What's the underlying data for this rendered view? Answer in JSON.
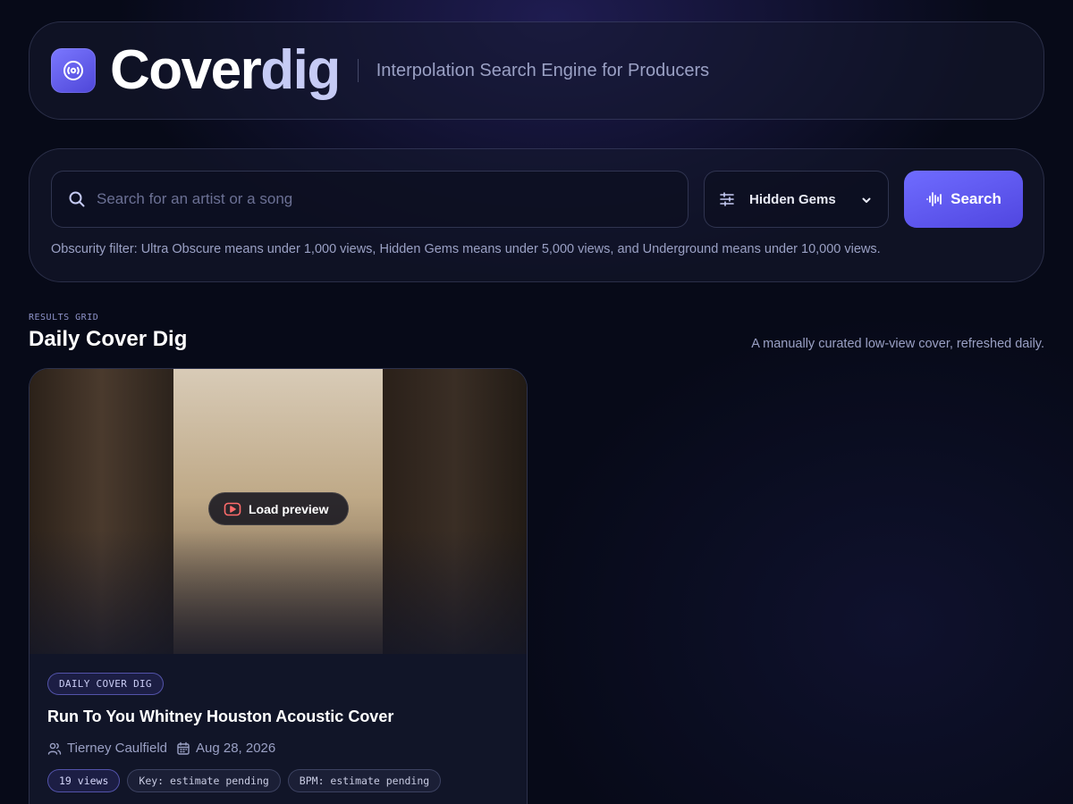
{
  "header": {
    "brand_part1": "Cover",
    "brand_part2": "dig",
    "tagline": "Interpolation Search Engine for Producers"
  },
  "search": {
    "placeholder": "Search for an artist or a song",
    "value": "",
    "filter_selected": "Hidden Gems",
    "filter_options": [
      "Ultra Obscure",
      "Hidden Gems",
      "Underground"
    ],
    "button_label": "Search",
    "filter_note": "Obscurity filter: Ultra Obscure means under 1,000 views, Hidden Gems means under 5,000 views, and Underground means under 10,000 views."
  },
  "results": {
    "eyebrow": "RESULTS GRID",
    "title": "Daily Cover Dig",
    "subtitle": "A manually curated low-view cover, refreshed daily."
  },
  "card": {
    "badge": "DAILY COVER DIG",
    "preview_label": "Load preview",
    "title": "Run To You Whitney Houston Acoustic Cover",
    "author": "Tierney Caulfield",
    "date": "Aug 28, 2026",
    "chips": {
      "views": "19 views",
      "key": "Key: estimate pending",
      "bpm": "BPM: estimate pending"
    }
  },
  "colors": {
    "background": "#070a18",
    "accent": "#5b55f0",
    "accent_light": "#c6cbf5",
    "muted_text": "#9aa0c4"
  },
  "icons": {
    "logo": "vinyl-disc-icon",
    "search": "search-icon",
    "filter": "sliders-icon",
    "chevron": "chevron-down-icon",
    "search_button": "audio-wave-icon",
    "preview": "video-play-icon",
    "author": "users-icon",
    "date": "calendar-icon"
  }
}
